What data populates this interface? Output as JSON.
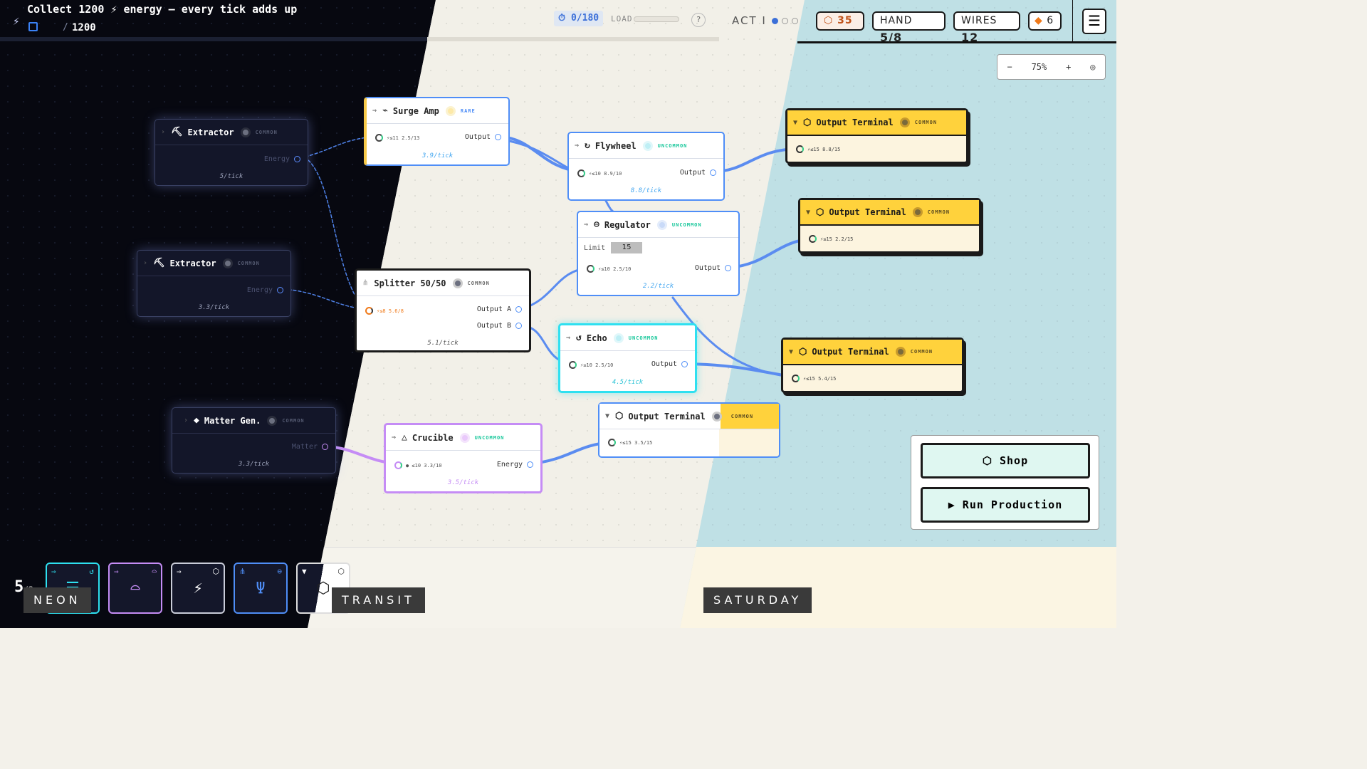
{
  "objective": {
    "title": "Collect 1200 ⚡ energy — every tick adds up",
    "separator": "/",
    "target": "1200"
  },
  "header": {
    "ticks": "⏱ 0/180",
    "load_label": "LOAD",
    "help": "?",
    "act": "ACT I",
    "coins": "35",
    "hand_label": "HAND",
    "hand_value": "5/8",
    "wires_label": "WIRES",
    "wires_value": "12",
    "gems": "6",
    "menu": "☰"
  },
  "zoom": {
    "minus": "−",
    "level": "75%",
    "plus": "+",
    "target": "◎"
  },
  "nodes": {
    "extractor1": {
      "name": "Extractor",
      "rarity": "COMMON",
      "port": "Energy",
      "rate": "5/tick"
    },
    "extractor2": {
      "name": "Extractor",
      "rarity": "COMMON",
      "port": "Energy",
      "rate": "3.3/tick"
    },
    "matter_gen": {
      "name": "Matter Gen.",
      "rarity": "COMMON",
      "port": "Matter",
      "rate": "3.3/tick"
    },
    "surge_amp": {
      "name": "Surge Amp",
      "rarity": "RARE",
      "in": "⚡≤11 2.5/13",
      "port": "Output",
      "rate": "3.9/tick"
    },
    "splitter": {
      "name": "Splitter 50/50",
      "rarity": "COMMON",
      "in": "⚡≤8 5.6/8",
      "port_a": "Output A",
      "port_b": "Output B",
      "rate": "5.1/tick"
    },
    "crucible": {
      "name": "Crucible",
      "rarity": "UNCOMMON",
      "in": "● ≤10 3.3/10",
      "port": "Energy",
      "rate": "3.5/tick"
    },
    "flywheel": {
      "name": "Flywheel",
      "rarity": "UNCOMMON",
      "in": "⚡≤10 8.9/10",
      "port": "Output",
      "rate": "8.8/tick"
    },
    "regulator": {
      "name": "Regulator",
      "rarity": "UNCOMMON",
      "limit_label": "Limit",
      "limit_value": "15",
      "in": "⚡≤10 2.5/10",
      "port": "Output",
      "rate": "2.2/tick"
    },
    "echo": {
      "name": "Echo",
      "rarity": "UNCOMMON",
      "in": "⚡≤10 2.5/10",
      "port": "Output",
      "rate": "4.5/tick"
    },
    "out_mid": {
      "name": "Output Terminal",
      "rarity": "COMMON",
      "in": "⚡≤15 3.5/15"
    },
    "out1": {
      "name": "Output Terminal",
      "rarity": "COMMON",
      "in": "⚡≤15 8.8/15"
    },
    "out2": {
      "name": "Output Terminal",
      "rarity": "COMMON",
      "in": "⚡≤15 2.2/15"
    },
    "out3": {
      "name": "Output Terminal",
      "rarity": "COMMON",
      "in": "⚡≤15 5.4/15"
    }
  },
  "actions": {
    "shop": "Shop",
    "run": "Run Production"
  },
  "hand": {
    "count": "5",
    "max": "/8"
  },
  "zones": {
    "neon": "NEON",
    "transit": "TRANSIT",
    "saturday": "SATURDAY"
  },
  "colors": {
    "neon_bg": "#070810",
    "transit_bg": "#f2f0e8",
    "saturday_bg": "#bfe0e5",
    "wire": "#5b8cf0",
    "terminal_yellow": "#ffd23c",
    "echo_cyan": "#2ee0f0",
    "crucible_purple": "#c58cf5"
  }
}
